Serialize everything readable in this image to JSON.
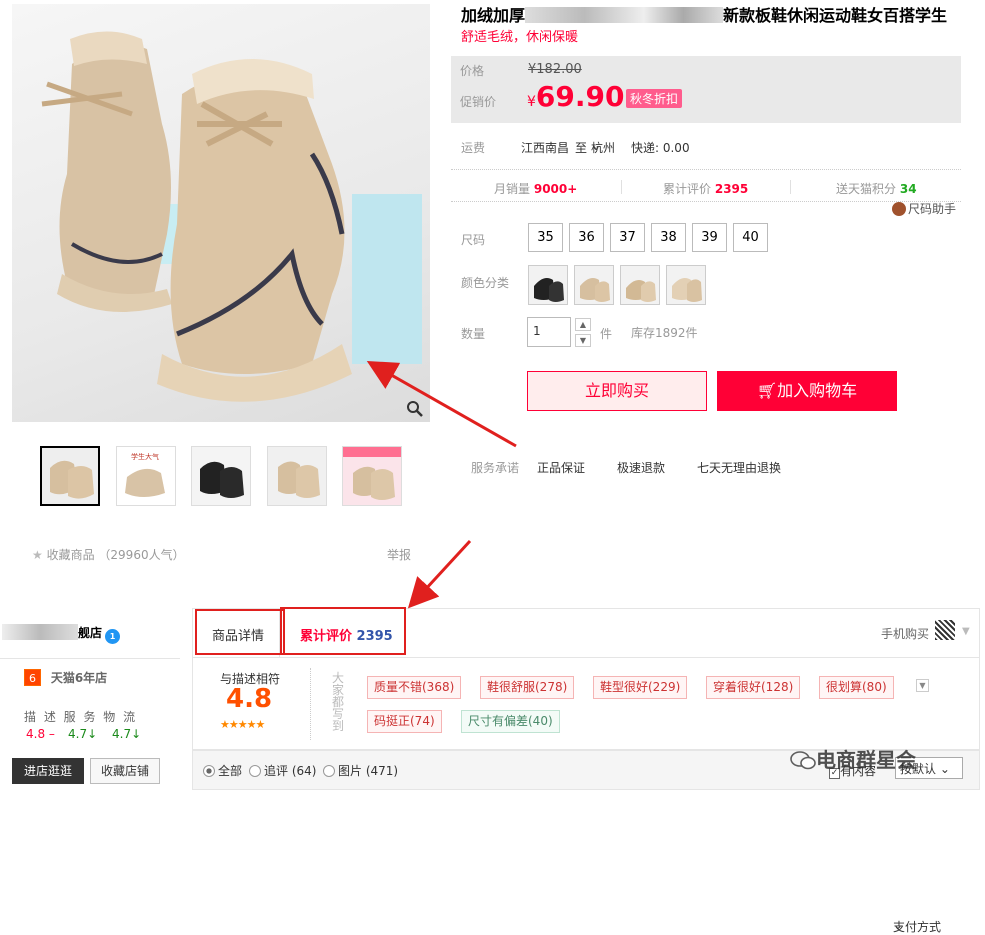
{
  "product": {
    "title_left": "加绒加厚",
    "title_right": "新款板鞋休闲运动鞋女百搭学生",
    "subtitle": "舒适毛绒，休闲保暖",
    "price_label": "价格",
    "original_price": "¥182.00",
    "promo_label": "促销价",
    "currency": "¥",
    "promo_price": "69.90",
    "promo_badge": "秋冬折扣",
    "shipping": {
      "label": "运费",
      "from": "江西南昌",
      "to_word": "至",
      "to": "杭州",
      "express": "快递: 0.00"
    },
    "stats": {
      "monthly_label": "月销量",
      "monthly_value": "9000+",
      "reviews_label": "累计评价",
      "reviews_value": "2395",
      "points_label": "送天猫积分",
      "points_value": "34"
    },
    "size_helper": "尺码助手",
    "size_label": "尺码",
    "sizes": [
      "35",
      "36",
      "37",
      "38",
      "39",
      "40"
    ],
    "color_label": "颜色分类",
    "qty_label": "数量",
    "qty_value": "1",
    "qty_unit": "件",
    "stock": "库存1892件",
    "buy_now": "立即购买",
    "add_cart": "加入购物车",
    "service_label": "服务承诺",
    "services": [
      "正品保证",
      "极速退款",
      "七天无理由退换"
    ],
    "payment": "支付方式",
    "favorite": "收藏商品 （29960人气）",
    "report": "举报"
  },
  "shop": {
    "name_suffix": "舰店",
    "badge_level": "6",
    "badge_text": "天猫6年店",
    "dsr_header": "描 述  服 务  物 流",
    "dsr": [
      {
        "value": "4.8",
        "trend": "–",
        "color": "#ff0036"
      },
      {
        "value": "4.7",
        "trend": "↓",
        "color": "#22aa22"
      },
      {
        "value": "4.7",
        "trend": "↓",
        "color": "#22aa22"
      }
    ],
    "enter_shop": "进店逛逛",
    "fav_shop": "收藏店铺"
  },
  "tabs": {
    "detail": "商品详情",
    "reviews_label": "累计评价",
    "reviews_count": "2395",
    "mobile_buy": "手机购买"
  },
  "ratings": {
    "match_label": "与描述相符",
    "score": "4.8",
    "stars": "★★★★★",
    "side_text": "大家都写到",
    "tags": [
      {
        "text": "质量不错(368)",
        "type": "pos"
      },
      {
        "text": "鞋很舒服(278)",
        "type": "pos"
      },
      {
        "text": "鞋型很好(229)",
        "type": "pos"
      },
      {
        "text": "穿着很好(128)",
        "type": "pos"
      },
      {
        "text": "很划算(80)",
        "type": "pos"
      },
      {
        "text": "码挺正(74)",
        "type": "pos"
      },
      {
        "text": "尺寸有偏差(40)",
        "type": "neg"
      }
    ],
    "filter_all": "全部",
    "filter_append": "追评 (64)",
    "filter_pics": "图片 (471)",
    "has_content": "有内容",
    "sort": "按默认"
  },
  "watermark": "电商群星会",
  "colors": {
    "accent": "#ff0036",
    "highlight_box": "#e0201e"
  }
}
